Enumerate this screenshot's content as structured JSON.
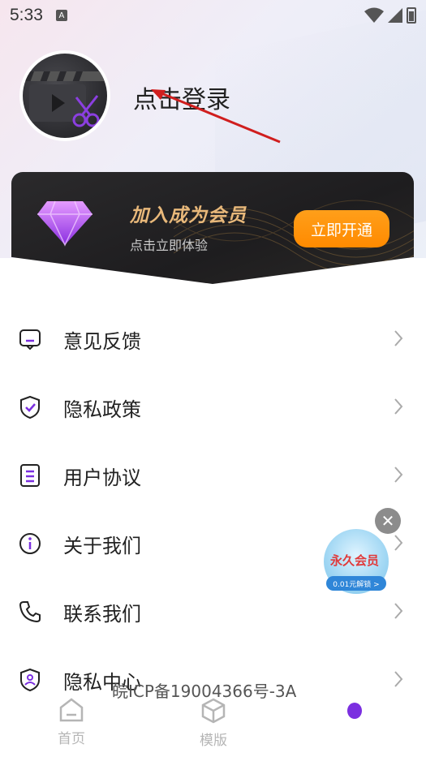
{
  "status_bar": {
    "time": "5:33",
    "notification_icon": "a-notification-icon",
    "wifi_icon": "wifi-icon",
    "signal_icon": "signal-icon",
    "battery_icon": "battery-icon"
  },
  "profile": {
    "avatar_icon": "film-scissors-icon",
    "login_label": "点击登录"
  },
  "vip": {
    "title": "加入成为会员",
    "subtitle": "点击立即体验",
    "button_label": "立即开通",
    "icon": "diamond-icon"
  },
  "menu": [
    {
      "label": "意见反馈",
      "icon": "feedback-icon"
    },
    {
      "label": "隐私政策",
      "icon": "shield-check-icon"
    },
    {
      "label": "用户协议",
      "icon": "document-icon"
    },
    {
      "label": "关于我们",
      "icon": "info-icon"
    },
    {
      "label": "联系我们",
      "icon": "phone-icon"
    },
    {
      "label": "隐私中心",
      "icon": "shield-user-icon"
    }
  ],
  "promo": {
    "title": "永久会员",
    "pill": "0.01元解锁 >",
    "close_icon": "close-icon"
  },
  "icp": "皖ICP备19004366号-3A",
  "tabs": [
    {
      "label": "首页",
      "icon": "home-icon"
    },
    {
      "label": "模版",
      "icon": "cube-icon"
    }
  ],
  "colors": {
    "accent_purple": "#7b2fe0",
    "vip_button": "#ff8a00",
    "vip_title": "#e8b87a"
  }
}
